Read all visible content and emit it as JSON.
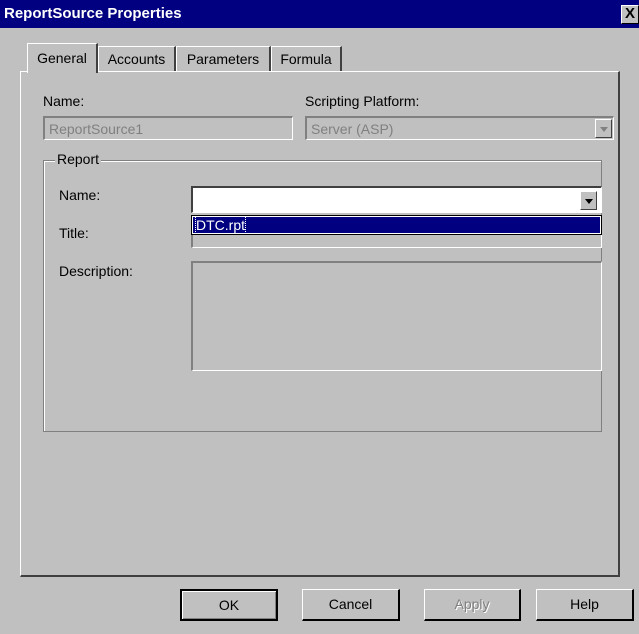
{
  "window": {
    "title": "ReportSource Properties",
    "close_glyph": "X"
  },
  "tabs": [
    {
      "label": "General",
      "active": true
    },
    {
      "label": "Accounts",
      "active": false
    },
    {
      "label": "Parameters",
      "active": false
    },
    {
      "label": "Formula",
      "active": false
    }
  ],
  "general": {
    "name_label": "Name:",
    "name_value": "ReportSource1",
    "platform_label": "Scripting Platform:",
    "platform_value": "Server (ASP)"
  },
  "report": {
    "group_title": "Report",
    "name_label": "Name:",
    "name_value": "",
    "title_label": "Title:",
    "description_label": "Description:",
    "dropdown_options": [
      "DTC.rpt"
    ]
  },
  "buttons": {
    "ok": "OK",
    "cancel": "Cancel",
    "apply": "Apply",
    "help": "Help"
  },
  "colors": {
    "titlebar": "#000080",
    "face": "#c0c0c0",
    "highlight": "#000080"
  }
}
